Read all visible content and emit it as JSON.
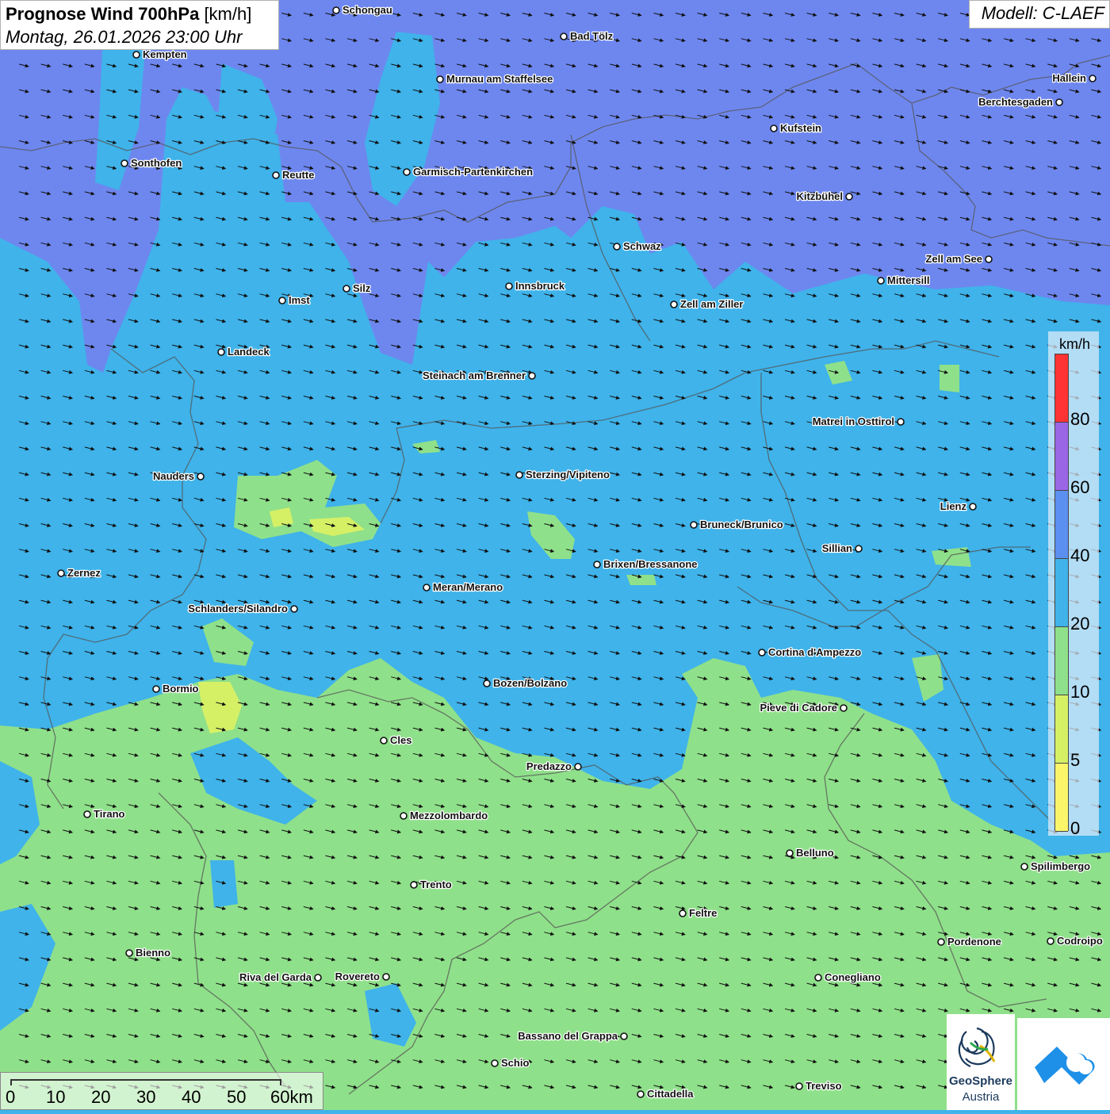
{
  "title": {
    "main_bold": "Prognose Wind 700hPa",
    "main_unit": "[km/h]",
    "datetime": "Montag, 26.01.2026 23:00 Uhr"
  },
  "model": "Modell: C-LAEF",
  "legend": {
    "unit": "km/h",
    "ticks": [
      "80",
      "60",
      "40",
      "20",
      "10",
      "5",
      "0"
    ],
    "colors": [
      "#ff3333",
      "#9a66e6",
      "#5b8ff0",
      "#3fb3ea",
      "#8fe08a",
      "#d6f066",
      "#fbf56a"
    ]
  },
  "scale": {
    "labels": [
      "0",
      "10",
      "20",
      "30",
      "40",
      "50",
      "60km"
    ]
  },
  "logos": {
    "geosphere_line1": "GeoSphere",
    "geosphere_line2": "Austria"
  },
  "colors": {
    "upper_band": "#6e87ef",
    "mid_band": "#3fb3ea",
    "low_band": "#8fe08a",
    "patch_yellow": "#d6f066",
    "arrow": "#111111",
    "border": "#555555"
  },
  "wind_direction": "east",
  "cities": [
    {
      "name": "Schongau"
    },
    {
      "name": "Bad Tölz"
    },
    {
      "name": "Kempten"
    },
    {
      "name": "Murnau am Staffelsee"
    },
    {
      "name": "Hallein"
    },
    {
      "name": "Berchtesgaden"
    },
    {
      "name": "Kufstein"
    },
    {
      "name": "Sonthofen"
    },
    {
      "name": "Reutte"
    },
    {
      "name": "Garmisch-Partenkirchen"
    },
    {
      "name": "Kitzbühel"
    },
    {
      "name": "Schwaz"
    },
    {
      "name": "Zell am See"
    },
    {
      "name": "Mittersill"
    },
    {
      "name": "Innsbruck"
    },
    {
      "name": "Silz"
    },
    {
      "name": "Imst"
    },
    {
      "name": "Zell am Ziller"
    },
    {
      "name": "Landeck"
    },
    {
      "name": "Steinach am Brenner"
    },
    {
      "name": "Matrei in Osttirol"
    },
    {
      "name": "Nauders"
    },
    {
      "name": "Sterzing/Vipiteno"
    },
    {
      "name": "Lienz"
    },
    {
      "name": "Bruneck/Brunico"
    },
    {
      "name": "Sillian"
    },
    {
      "name": "Zernez"
    },
    {
      "name": "Brixen/Bressanone"
    },
    {
      "name": "Meran/Merano"
    },
    {
      "name": "Schlanders/Silandro"
    },
    {
      "name": "Cortina d'Ampezzo"
    },
    {
      "name": "Bormio"
    },
    {
      "name": "Bozen/Bolzano"
    },
    {
      "name": "Pieve di Cadore"
    },
    {
      "name": "Cles"
    },
    {
      "name": "Predazzo"
    },
    {
      "name": "Tirano"
    },
    {
      "name": "Mezzolombardo"
    },
    {
      "name": "Belluno"
    },
    {
      "name": "Spilimbergo"
    },
    {
      "name": "Trento"
    },
    {
      "name": "Feltre"
    },
    {
      "name": "Bienno"
    },
    {
      "name": "Pordenone"
    },
    {
      "name": "Codroipo"
    },
    {
      "name": "Riva del Garda"
    },
    {
      "name": "Rovereto"
    },
    {
      "name": "Conegliano"
    },
    {
      "name": "Bassano del Grappa"
    },
    {
      "name": "Schio"
    },
    {
      "name": "Treviso"
    },
    {
      "name": "Cittadella"
    }
  ]
}
